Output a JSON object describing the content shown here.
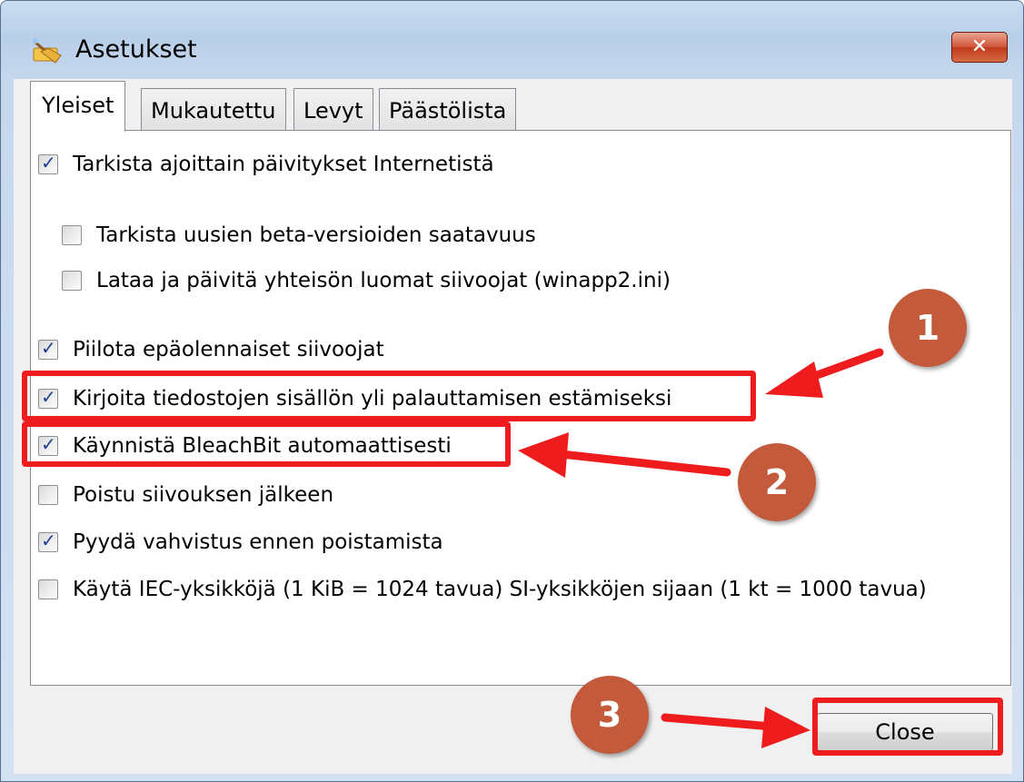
{
  "window": {
    "title": "Asetukset",
    "close_glyph": "✕"
  },
  "tabs": [
    {
      "label": "Yleiset",
      "active": true
    },
    {
      "label": "Mukautettu",
      "active": false
    },
    {
      "label": "Levyt",
      "active": false
    },
    {
      "label": "Päästölista",
      "active": false
    }
  ],
  "options": [
    {
      "label": "Tarkista ajoittain päivitykset Internetistä",
      "checked": true
    },
    {
      "label": "Tarkista uusien beta-versioiden saatavuus",
      "checked": false
    },
    {
      "label": "Lataa ja päivitä yhteisön luomat siivoojat (winapp2.ini)",
      "checked": false
    },
    {
      "label": "Piilota epäolennaiset siivoojat",
      "checked": true
    },
    {
      "label": "Kirjoita tiedostojen sisällön yli palauttamisen estämiseksi",
      "checked": true
    },
    {
      "label": "Käynnistä BleachBit automaattisesti",
      "checked": true
    },
    {
      "label": "Poistu siivouksen jälkeen",
      "checked": false
    },
    {
      "label": "Pyydä vahvistus ennen poistamista",
      "checked": true
    },
    {
      "label": "Käytä IEC-yksikköjä (1 KiB = 1024 tavua) SI-yksikköjen sijaan (1 kt = 1000 tavua)",
      "checked": false
    }
  ],
  "buttons": {
    "close": "Close"
  },
  "annotations": {
    "badges": [
      "1",
      "2",
      "3"
    ],
    "badge_color": "#c45a3c",
    "highlight_color": "#ee1c1c"
  },
  "icons": {
    "app": "broom-icon",
    "checkmark": "✓"
  }
}
